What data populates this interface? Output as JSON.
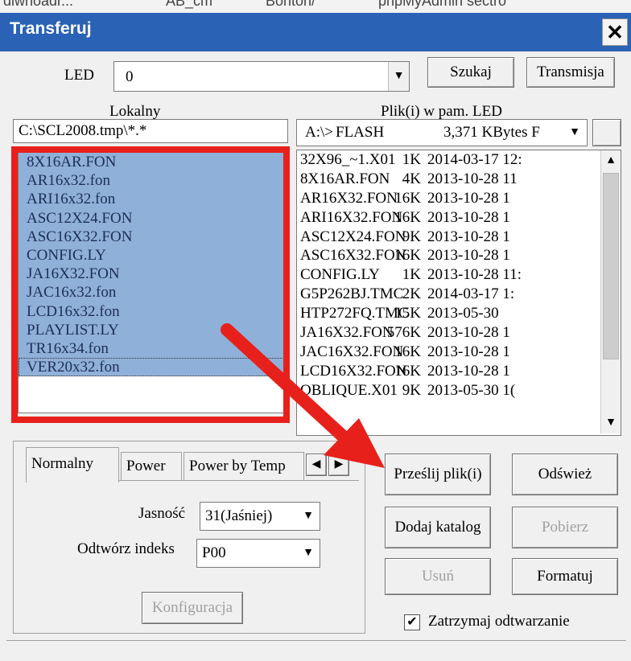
{
  "background_window": {
    "items": [
      "dlwnoadr...",
      "AB_cm",
      "Bonton/",
      "phpMyAdmin sectro"
    ]
  },
  "window": {
    "title": "Transferuj",
    "close_glyph": "✕"
  },
  "top": {
    "led_label": "LED",
    "led_value": "0",
    "search_button": "Szukaj",
    "transmit_button": "Transmisja"
  },
  "local": {
    "heading": "Lokalny",
    "path": "C:\\SCL2008.tmp\\*.*",
    "files": [
      "8X16AR.FON",
      "AR16x32.fon",
      "ARI16x32.fon",
      "ASC12X24.FON",
      "ASC16X32.FON",
      "CONFIG.LY",
      "JA16X32.FON",
      "JAC16x32.fon",
      "LCD16x32.fon",
      "PLAYLIST.LY",
      "TR16x34.fon",
      "VER20x32.fon"
    ]
  },
  "led_memory": {
    "heading": "Plik(i) w pam. LED",
    "drive": "A:\\>",
    "storage": "FLASH",
    "free": "3,371 KBytes F",
    "files": [
      {
        "name": "32X96_~1.X01",
        "size": "1K",
        "date": "2014-03-17 12:"
      },
      {
        "name": "8X16AR.FON",
        "size": "4K",
        "date": "2013-10-28 11"
      },
      {
        "name": "AR16X32.FON",
        "size": "16K",
        "date": "2013-10-28 1"
      },
      {
        "name": "ARI16X32.FON",
        "size": "16K",
        "date": "2013-10-28 1"
      },
      {
        "name": "ASC12X24.FON",
        "size": "9K",
        "date": "2013-10-28 1"
      },
      {
        "name": "ASC16X32.FON",
        "size": "16K",
        "date": "2013-10-28 1"
      },
      {
        "name": "CONFIG.LY",
        "size": "1K",
        "date": "2013-10-28 11:"
      },
      {
        "name": "G5P262BJ.TMC",
        "size": "2K",
        "date": "2014-03-17 1:"
      },
      {
        "name": "HTP272FQ.TMC",
        "size": "15K",
        "date": "2013-05-30"
      },
      {
        "name": "JA16X32.FON",
        "size": "576K",
        "date": "2013-10-28 1"
      },
      {
        "name": "JAC16X32.FON",
        "size": "16K",
        "date": "2013-10-28 1"
      },
      {
        "name": "LCD16X32.FON",
        "size": "16K",
        "date": "2013-10-28 1"
      },
      {
        "name": "OBLIQUE.X01",
        "size": "9K",
        "date": "2013-05-30 1("
      }
    ]
  },
  "tabs": [
    "Normalny",
    "Power",
    "Power by Temp"
  ],
  "settings": {
    "brightness_label": "Jasność",
    "brightness_value": "31(Jaśniej)",
    "index_label": "Odtwórz indeks",
    "index_value": "P00",
    "config_button": "Konfiguracja"
  },
  "actions": {
    "send": "Prześlij plik(i)",
    "refresh": "Odśwież",
    "add_dir": "Dodaj katalog",
    "download": "Pobierz",
    "delete": "Usuń",
    "format": "Formatuj",
    "stop_play_label": "Zatrzymaj odtwarzanie",
    "stop_play_checked": true
  },
  "annotation": {
    "color": "#e8201c"
  }
}
